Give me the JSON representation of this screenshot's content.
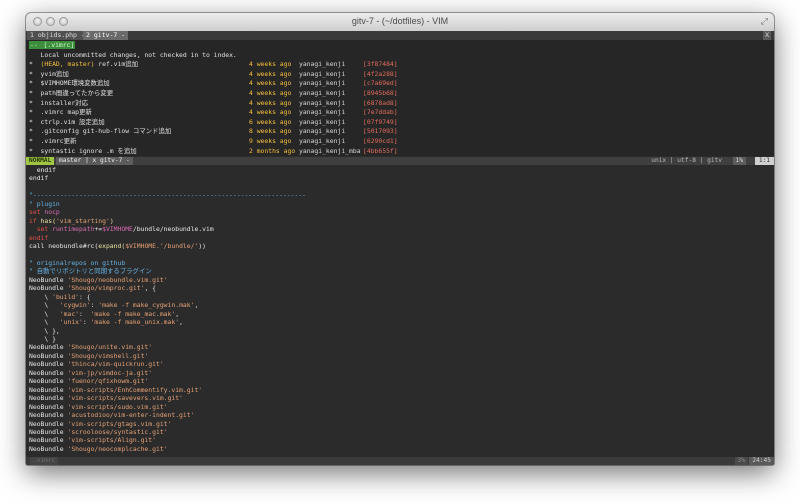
{
  "window": {
    "title": "gitv-7 - (~/dotfiles) - VIM"
  },
  "tabs": [
    {
      "label": "1 objids.php -"
    },
    {
      "label": "2 gitv-7 -"
    }
  ],
  "tabline_right": "X",
  "gitv": {
    "rows": [
      {
        "bullet": "-- ",
        "ref": "[.vimrc]",
        "msg": "",
        "date": "",
        "author": "",
        "hash": ""
      },
      {
        "bullet": "   ",
        "ref": "",
        "msg": "Local uncommitted changes, not checked in to index.",
        "date": "",
        "author": "",
        "hash": ""
      },
      {
        "bullet": "*  ",
        "ref": "(HEAD, master)",
        "msg": " ref.vim追加",
        "date": "4 weeks ago",
        "author": "yanagi_kenji",
        "hash": "[3f87484]"
      },
      {
        "bullet": "*  ",
        "ref": "",
        "msg": "yvim追加",
        "date": "4 weeks ago",
        "author": "yanagi_kenji",
        "hash": "[4f2a288]"
      },
      {
        "bullet": "*  ",
        "ref": "",
        "msg": "$VIMHOME環境変数追加",
        "date": "4 weeks ago",
        "author": "yanagi_kenji",
        "hash": "[c7a69ed]"
      },
      {
        "bullet": "*  ",
        "ref": "",
        "msg": "path間違ってたから変更",
        "date": "4 weeks ago",
        "author": "yanagi_kenji",
        "hash": "[8945b68]"
      },
      {
        "bullet": "*  ",
        "ref": "",
        "msg": "installer対応",
        "date": "4 weeks ago",
        "author": "yanagi_kenji",
        "hash": "[6878ad8]"
      },
      {
        "bullet": "*  ",
        "ref": "",
        "msg": ".vimrc map更新",
        "date": "4 weeks ago",
        "author": "yanagi_kenji",
        "hash": "[7e7ddab]"
      },
      {
        "bullet": "*  ",
        "ref": "",
        "msg": "ctrlp.vim 設定追加",
        "date": "6 weeks ago",
        "author": "yanagi_kenji",
        "hash": "[07f9749]"
      },
      {
        "bullet": "*  ",
        "ref": "",
        "msg": ".gitconfig git-hub-flow コマンド追加",
        "date": "8 weeks ago",
        "author": "yanagi_kenji",
        "hash": "[5017093]"
      },
      {
        "bullet": "*  ",
        "ref": "",
        "msg": ".vimrc更新",
        "date": "9 weeks ago",
        "author": "yanagi_kenji",
        "hash": "[6290cd1]"
      },
      {
        "bullet": "*  ",
        "ref": "",
        "msg": "syntastic ignore .m を追加",
        "date": "2 months ago",
        "author": "yanagi_kenji_mba",
        "hash": "[4bb655f]"
      }
    ]
  },
  "statusline": {
    "mode": "NORMAL",
    "branch": "master | x gitv-7 -",
    "info": "unix | utf-8 | gitv",
    "percent": "1%",
    "position": "1:1"
  },
  "code": {
    "lines": [
      [
        {
          "t": "  endif",
          "c": ""
        }
      ],
      [
        {
          "t": "endif",
          "c": ""
        }
      ],
      [
        {
          "t": "",
          "c": ""
        }
      ],
      [
        {
          "t": "\"-----------------------------------------------------------------------",
          "c": "sep"
        }
      ],
      [
        {
          "t": "\" plugin",
          "c": "cm"
        }
      ],
      [
        {
          "t": "set ",
          "c": "kw"
        },
        {
          "t": "nocp",
          "c": "var"
        }
      ],
      [
        {
          "t": "if ",
          "c": "kw"
        },
        {
          "t": "has(",
          "c": "fn"
        },
        {
          "t": "'vim_starting'",
          "c": "str"
        },
        {
          "t": ")",
          "c": "fn"
        }
      ],
      [
        {
          "t": "  set ",
          "c": "kw"
        },
        {
          "t": "runtimepath",
          "c": "var"
        },
        {
          "t": "+=",
          "c": ""
        },
        {
          "t": "$VIMHOME",
          "c": "var"
        },
        {
          "t": "/bundle/neobundle.vim",
          "c": ""
        }
      ],
      [
        {
          "t": "endif",
          "c": "kw"
        }
      ],
      [
        {
          "t": "call neobundle#rc(",
          "c": ""
        },
        {
          "t": "expand(",
          "c": "fn"
        },
        {
          "t": "$VIMHOME.'/bundle/'",
          "c": "str"
        },
        {
          "t": "))",
          "c": ""
        }
      ],
      [
        {
          "t": "",
          "c": ""
        }
      ],
      [
        {
          "t": "\" originalrepos on github",
          "c": "cm"
        }
      ],
      [
        {
          "t": "\" 自動でリポジトリと同期するプラグイン",
          "c": "cm"
        }
      ],
      [
        {
          "t": "NeoBundle ",
          "c": ""
        },
        {
          "t": "'Shougo/neobundle.vim.git'",
          "c": "str"
        }
      ],
      [
        {
          "t": "NeoBundle ",
          "c": ""
        },
        {
          "t": "'Shougo/vimproc.git'",
          "c": "str"
        },
        {
          "t": ", {",
          "c": ""
        }
      ],
      [
        {
          "t": "    \\ ",
          "c": ""
        },
        {
          "t": "'build'",
          "c": "str"
        },
        {
          "t": ": {",
          "c": ""
        }
      ],
      [
        {
          "t": "    \\   ",
          "c": ""
        },
        {
          "t": "'cygwin'",
          "c": "str"
        },
        {
          "t": ": ",
          "c": ""
        },
        {
          "t": "'make -f make_cygwin.mak'",
          "c": "str"
        },
        {
          "t": ",",
          "c": ""
        }
      ],
      [
        {
          "t": "    \\   ",
          "c": ""
        },
        {
          "t": "'mac'",
          "c": "str"
        },
        {
          "t": ":  ",
          "c": ""
        },
        {
          "t": "'make -f make_mac.mak'",
          "c": "str"
        },
        {
          "t": ",",
          "c": ""
        }
      ],
      [
        {
          "t": "    \\   ",
          "c": ""
        },
        {
          "t": "'unix'",
          "c": "str"
        },
        {
          "t": ": ",
          "c": ""
        },
        {
          "t": "'make -f make_unix.mak'",
          "c": "str"
        },
        {
          "t": ",",
          "c": ""
        }
      ],
      [
        {
          "t": "    \\ },",
          "c": ""
        }
      ],
      [
        {
          "t": "    \\ }",
          "c": ""
        }
      ],
      [
        {
          "t": "NeoBundle ",
          "c": ""
        },
        {
          "t": "'Shougo/unite.vim.git'",
          "c": "str"
        }
      ],
      [
        {
          "t": "NeoBundle ",
          "c": ""
        },
        {
          "t": "'Shougo/vimshell.git'",
          "c": "str"
        }
      ],
      [
        {
          "t": "NeoBundle ",
          "c": ""
        },
        {
          "t": "'thinca/vim-quickrun.git'",
          "c": "str"
        }
      ],
      [
        {
          "t": "NeoBundle ",
          "c": ""
        },
        {
          "t": "'vim-jp/vimdoc-ja.git'",
          "c": "str"
        }
      ],
      [
        {
          "t": "NeoBundle ",
          "c": ""
        },
        {
          "t": "'fuenor/qfixhowm.git'",
          "c": "str"
        }
      ],
      [
        {
          "t": "NeoBundle ",
          "c": ""
        },
        {
          "t": "'vim-scripts/EnhCommentify.vim.git'",
          "c": "str"
        }
      ],
      [
        {
          "t": "NeoBundle ",
          "c": ""
        },
        {
          "t": "'vim-scripts/savevers.vim.git'",
          "c": "str"
        }
      ],
      [
        {
          "t": "NeoBundle ",
          "c": ""
        },
        {
          "t": "'vim-scripts/sudo.vim.git'",
          "c": "str"
        }
      ],
      [
        {
          "t": "NeoBundle ",
          "c": ""
        },
        {
          "t": "'acustodioo/vim-enter-indent.git'",
          "c": "str"
        }
      ],
      [
        {
          "t": "NeoBundle ",
          "c": ""
        },
        {
          "t": "'vim-scripts/gtags.vim.git'",
          "c": "str"
        }
      ],
      [
        {
          "t": "NeoBundle ",
          "c": ""
        },
        {
          "t": "'scrooloose/syntastic.git'",
          "c": "str"
        }
      ],
      [
        {
          "t": "NeoBundle ",
          "c": ""
        },
        {
          "t": "'vim-scripts/Align.git'",
          "c": "str"
        }
      ],
      [
        {
          "t": "NeoBundle ",
          "c": ""
        },
        {
          "t": "'Shougo/neocomplcache.git'",
          "c": "str"
        }
      ]
    ]
  },
  "bottomline": {
    "file": ".vimrc",
    "percent": "3%",
    "position": "24:45"
  }
}
